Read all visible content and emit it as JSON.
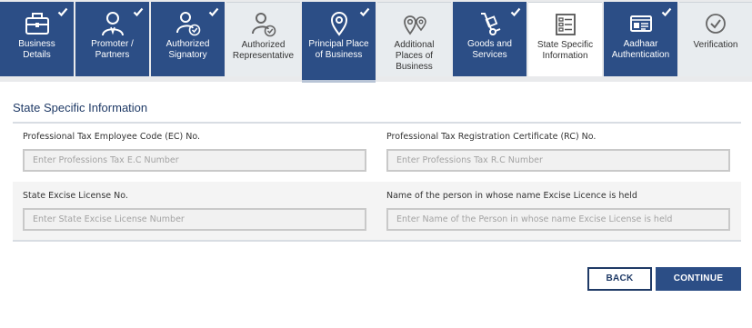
{
  "tabs": [
    {
      "label": "Business Details",
      "status": "done",
      "icon": "briefcase-icon"
    },
    {
      "label": "Promoter / Partners",
      "status": "done",
      "icon": "person-icon"
    },
    {
      "label": "Authorized Signatory",
      "status": "done",
      "icon": "signatory-icon"
    },
    {
      "label": "Authorized Representative",
      "status": "todo",
      "icon": "representative-icon"
    },
    {
      "label": "Principal Place of Business",
      "status": "done",
      "icon": "location-pin-icon"
    },
    {
      "label": "Additional Places of Business",
      "status": "todo",
      "icon": "multiple-pins-icon"
    },
    {
      "label": "Goods and Services",
      "status": "done",
      "icon": "hand-truck-icon"
    },
    {
      "label": "State Specific Information",
      "status": "active",
      "icon": "form-list-icon"
    },
    {
      "label": "Aadhaar Authentication",
      "status": "done",
      "icon": "id-card-icon"
    },
    {
      "label": "Verification",
      "status": "todo",
      "icon": "check-circle-icon"
    }
  ],
  "section": {
    "title": "State Specific Information"
  },
  "form": {
    "ec": {
      "label": "Professional Tax Employee Code (EC) No.",
      "placeholder": "Enter Professions Tax E.C Number",
      "value": ""
    },
    "rc": {
      "label": "Professional Tax Registration Certificate (RC) No.",
      "placeholder": "Enter Professions Tax R.C Number",
      "value": ""
    },
    "excise_license": {
      "label": "State Excise License No.",
      "placeholder": "Enter State Excise License Number",
      "value": ""
    },
    "excise_holder": {
      "label": "Name of the person in whose name Excise Licence is held",
      "placeholder": "Enter Name of the Person in whose name Excise License is held",
      "value": ""
    }
  },
  "buttons": {
    "back": "BACK",
    "continue": "CONTINUE"
  },
  "colors": {
    "primary": "#2c4e86",
    "heading": "#1f3a66",
    "inactive_tab": "#e8ecef",
    "page_bg": "#ffffff"
  }
}
